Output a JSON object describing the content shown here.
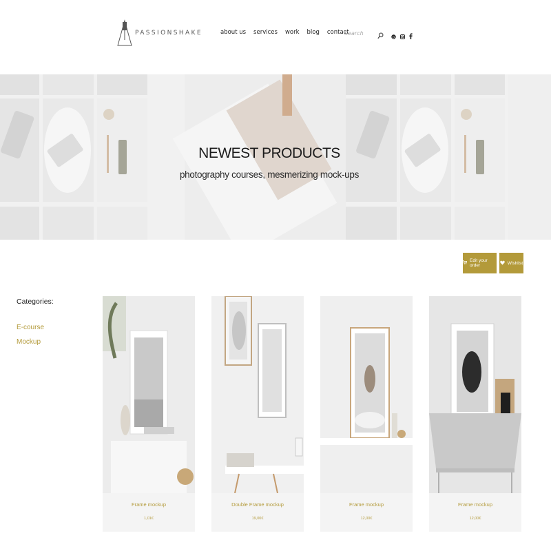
{
  "header": {
    "logo_text": "PASSIONSHAKE",
    "nav": [
      {
        "label": "about us"
      },
      {
        "label": "services"
      },
      {
        "label": "work"
      },
      {
        "label": "blog"
      },
      {
        "label": "contact"
      }
    ],
    "search_placeholder": "Search",
    "search_icon": "search-icon",
    "social_icons": [
      "pinterest-icon",
      "instagram-icon",
      "facebook-icon"
    ]
  },
  "hero": {
    "title": "NEWEST PRODUCTS",
    "subtitle": "photography courses, mesmerizing mock-ups"
  },
  "actions": {
    "edit_order": "Edit your order",
    "wishlist": "Wishlist"
  },
  "categories": {
    "title": "Categories:",
    "items": [
      "E-course",
      "Mockup"
    ]
  },
  "products": [
    {
      "name": "Frame mockup",
      "price": "1,01€"
    },
    {
      "name": "Double Frame mockup",
      "price": "19,00€"
    },
    {
      "name": "Frame mockup",
      "price": "12,00€"
    },
    {
      "name": "Frame mockup",
      "price": "12,00€"
    }
  ],
  "colors": {
    "accent": "#b39a3a",
    "hero_bg": "#ececec",
    "card_bg": "#f4f4f4"
  }
}
